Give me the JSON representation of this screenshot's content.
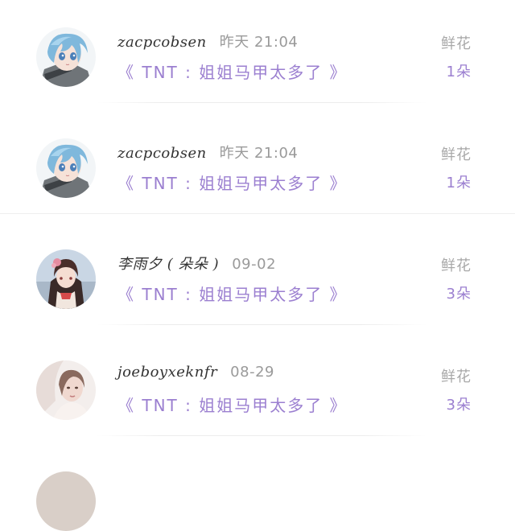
{
  "comments": [
    {
      "username": "zacpcobsen",
      "time": "昨天 21:04",
      "novel": "《 TNT : 姐姐马甲太多了 》",
      "gift_label": "鲜花",
      "gift_count": "1朵",
      "avatar": "anime-girl-blue-hair"
    },
    {
      "username": "zacpcobsen",
      "time": "昨天 21:04",
      "novel": "《 TNT : 姐姐马甲太多了 》",
      "gift_label": "鲜花",
      "gift_count": "1朵",
      "avatar": "anime-girl-blue-hair"
    },
    {
      "username": "李雨夕 ( 朵朵 )",
      "time": "09-02",
      "novel": "《 TNT : 姐姐马甲太多了 》",
      "gift_label": "鲜花",
      "gift_count": "3朵",
      "avatar": "anime-girl-flower"
    },
    {
      "username": "joeboyxeknfr",
      "time": "08-29",
      "novel": "《 TNT : 姐姐马甲太多了 》",
      "gift_label": "鲜花",
      "gift_count": "3朵",
      "avatar": "photo-woman"
    }
  ],
  "colors": {
    "accent_purple": "#9b7fd0",
    "muted_gray": "#a8a8a8",
    "text_dark": "#333333"
  }
}
